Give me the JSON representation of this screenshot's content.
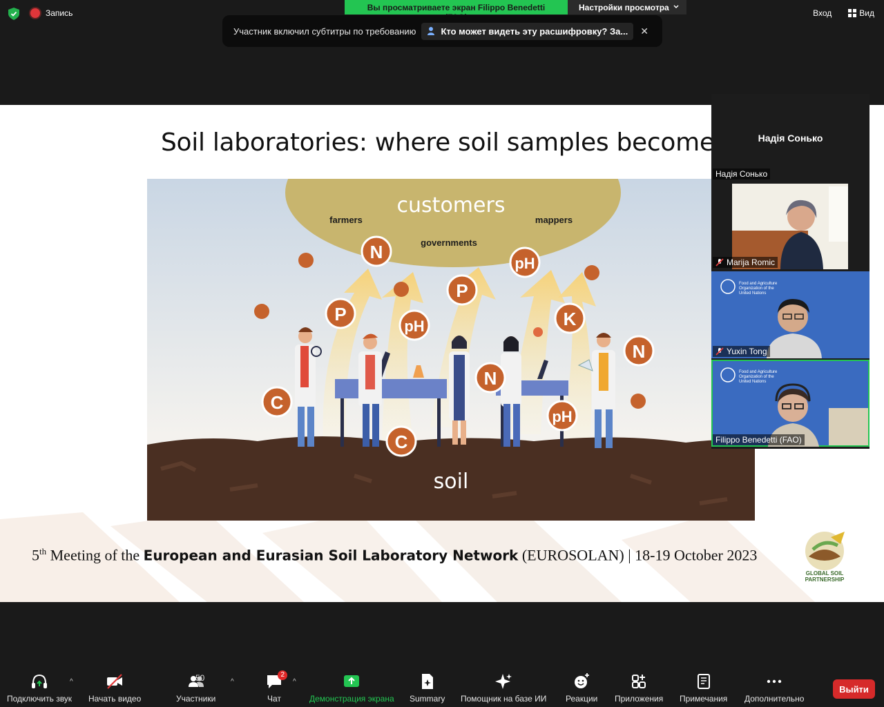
{
  "topbar": {
    "recording_label": "Запись",
    "share_banner": "Вы просматриваете экран Filippo Benedetti (FAO)",
    "view_options": "Настройки просмотра",
    "enter_label": "Вход",
    "view_label": "Вид"
  },
  "toast": {
    "text": "Участник включил субтитры по требованию",
    "link": "Кто может видеть эту расшифровку? За...",
    "close": "✕"
  },
  "slide": {
    "title": "Soil laboratories: where soil samples become data",
    "illustration": {
      "customers": "customers",
      "farmers": "farmers",
      "mappers": "mappers",
      "governments": "governments",
      "soil": "soil",
      "nutrients": [
        "N",
        "pH",
        "P",
        "P",
        "pH",
        "K",
        "N",
        "N",
        "C",
        "pH",
        "C"
      ]
    },
    "footer": {
      "ordinal_num": "5",
      "ordinal_sup": "th",
      "pre": " Meeting of the ",
      "bold": "European and Eurasian Soil Laboratory Network",
      "post": " (EUROSOLAN) |  18-19 October 2023"
    },
    "logo_text_1": "GLOBAL SOIL",
    "logo_text_2": "PARTNERSHIP"
  },
  "participants": [
    {
      "name": "Надія Сонько",
      "center_name": "Надія Сонько",
      "muted": false
    },
    {
      "name": "Marija Romic",
      "muted": true
    },
    {
      "name": "Yuxin Tong",
      "muted": true,
      "org": [
        "Food and Agriculture",
        "Organization of the",
        "United Nations"
      ]
    },
    {
      "name": "Filippo Benedetti (FAO)",
      "muted": false,
      "org": [
        "Food and Agriculture",
        "Organization of the",
        "United Nations"
      ]
    }
  ],
  "toolbar": {
    "audio": "Подключить звук",
    "video": "Начать видео",
    "participants": "Участники",
    "participants_count": "50",
    "chat": "Чат",
    "chat_badge": "2",
    "share": "Демонстрация экрана",
    "summary": "Summary",
    "ai": "Помощник на базе ИИ",
    "reactions": "Реакции",
    "apps": "Приложения",
    "notes": "Примечания",
    "more": "Дополнительно",
    "leave": "Выйти"
  },
  "colors": {
    "share_green": "#23c552",
    "nutrient_orange": "#c5622c",
    "customers_tan": "#c8b56e",
    "leave_red": "#d62a2a"
  }
}
